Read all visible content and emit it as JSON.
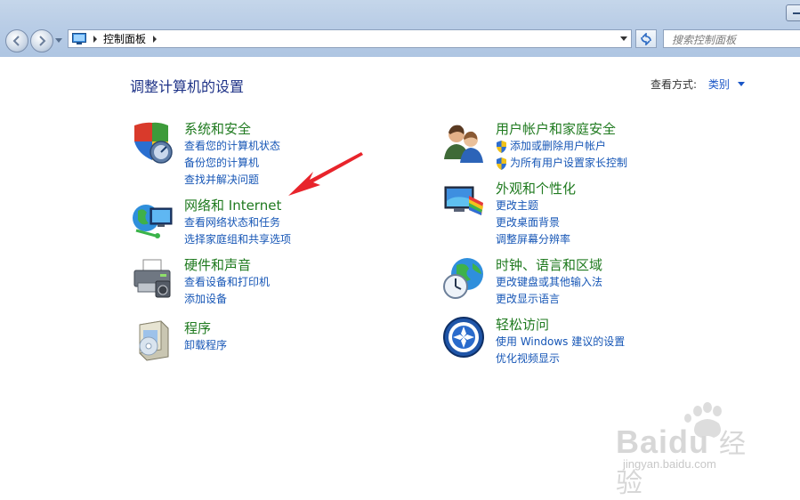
{
  "address": {
    "path": "控制面板"
  },
  "search": {
    "placeholder": "搜索控制面板"
  },
  "header": {
    "title": "调整计算机的设置",
    "view_by_label": "查看方式:",
    "view_by_value": "类别"
  },
  "categories_left": [
    {
      "title": "系统和安全",
      "icon": "security-shield-icon",
      "links": [
        "查看您的计算机状态",
        "备份您的计算机",
        "查找并解决问题"
      ]
    },
    {
      "title": "网络和 Internet",
      "icon": "network-globe-icon",
      "links": [
        "查看网络状态和任务",
        "选择家庭组和共享选项"
      ]
    },
    {
      "title": "硬件和声音",
      "icon": "printer-icon",
      "links": [
        "查看设备和打印机",
        "添加设备"
      ]
    },
    {
      "title": "程序",
      "icon": "programs-box-icon",
      "links": [
        "卸载程序"
      ]
    }
  ],
  "categories_right": [
    {
      "title": "用户帐户和家庭安全",
      "icon": "users-icon",
      "links": [
        "添加或删除用户帐户",
        "为所有用户设置家长控制"
      ]
    },
    {
      "title": "外观和个性化",
      "icon": "display-paint-icon",
      "links": [
        "更改主题",
        "更改桌面背景",
        "调整屏幕分辨率"
      ]
    },
    {
      "title": "时钟、语言和区域",
      "icon": "clock-globe-icon",
      "links": [
        "更改键盘或其他输入法",
        "更改显示语言"
      ]
    },
    {
      "title": "轻松访问",
      "icon": "ease-of-access-icon",
      "links": [
        "使用 Windows 建议的设置",
        "优化视频显示"
      ]
    }
  ],
  "watermark": {
    "brand": "Bai",
    "brand2": "du",
    "brand_cn": "经验",
    "url": "jingyan.baidu.com"
  },
  "colors": {
    "heading_green": "#1f7a1f",
    "link_blue": "#1656b6",
    "title_blue": "#1e3287",
    "annotation_red": "#e8242b"
  }
}
